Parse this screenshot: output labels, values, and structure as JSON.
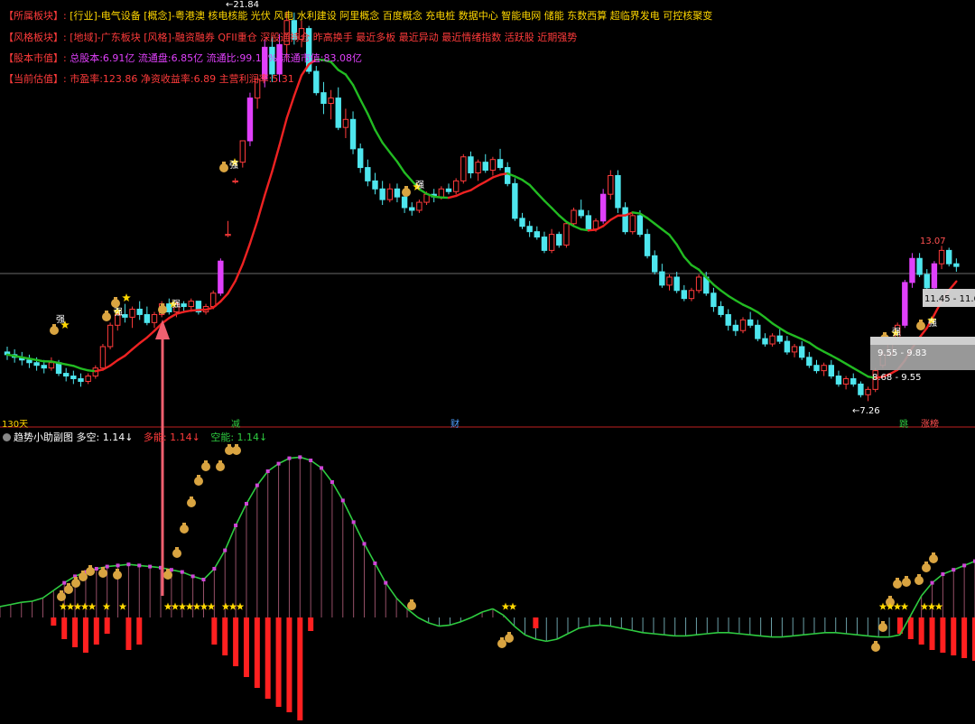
{
  "info": {
    "sector": {
      "tag": "【所属板块】:",
      "text": "[行业]-电气设备 [概念]-粤港澳 核电核能 光伏 风电 水利建设 阿里概念 百度概念 充电桩 数据中心 智能电网 储能 东数西算 超临界发电 可控核聚变"
    },
    "style": {
      "tag": "【风格板块】:",
      "text": "[地域]-广东板块 [风格]-融资融券 QFII重仓 深股通持仓 昨高换手 最近多板 最近异动 最近情绪指数 活跃股 近期强势"
    },
    "capital": {
      "tag": "【股本市值】:",
      "text": "总股本:6.91亿 流通盘:6.85亿 流通比:99.14% 流通市值:83.08亿"
    },
    "valuation": {
      "tag": "【当前估值】:",
      "text": "市盈率:123.86 净资收益率:6.89 主营利润率:5.31"
    }
  },
  "labels": {
    "high_price": "←21.84",
    "low_price": "←7.26",
    "right_high": "13.07",
    "zone_upper": "11.45 - 11.6",
    "zone_middle": "9.55 - 9.83",
    "zone_lower": "8.68 - 9.55",
    "period": "130天",
    "marker_reduce": "减",
    "marker_finance": "财",
    "marker_jump": "跳",
    "marker_limit": "涨榜",
    "strong": "强"
  },
  "indicator": {
    "name": "趋势小助副图",
    "ls_label": "多空: 1.14↓",
    "long_label": "多能: 1.14↓",
    "short_label": "空能: 1.14↓"
  },
  "colors": {
    "up": "#ff3b3b",
    "down": "#4ee6ee",
    "magenta": "#e040fb",
    "ma_rise": "#ee2222",
    "ma_fall": "#22bb22",
    "star": "#ffd700",
    "bag": "#d9a441"
  },
  "chart_data": {
    "type": "candlestick",
    "price_range": [
      7.26,
      21.84
    ],
    "candles": [
      [
        9.1,
        9.3,
        8.8,
        9.0
      ],
      [
        9.0,
        9.2,
        8.7,
        8.9
      ],
      [
        8.9,
        9.1,
        8.6,
        8.8
      ],
      [
        8.8,
        9.0,
        8.5,
        8.7
      ],
      [
        8.7,
        8.9,
        8.4,
        8.6
      ],
      [
        8.6,
        8.8,
        8.3,
        8.5
      ],
      [
        8.5,
        8.9,
        8.4,
        8.7
      ],
      [
        8.7,
        8.8,
        8.2,
        8.3
      ],
      [
        8.3,
        8.5,
        8.0,
        8.2
      ],
      [
        8.2,
        8.4,
        7.9,
        8.1
      ],
      [
        8.1,
        8.3,
        7.8,
        8.0
      ],
      [
        8.0,
        8.3,
        7.9,
        8.2
      ],
      [
        8.2,
        8.6,
        8.1,
        8.5
      ],
      [
        8.5,
        9.4,
        8.4,
        9.3
      ],
      [
        9.3,
        10.2,
        9.2,
        10.1
      ],
      [
        10.1,
        10.7,
        9.9,
        10.5
      ],
      [
        10.5,
        10.9,
        10.2,
        10.4
      ],
      [
        10.4,
        10.8,
        10.0,
        10.7
      ],
      [
        10.7,
        11.0,
        10.3,
        10.5
      ],
      [
        10.5,
        10.8,
        10.1,
        10.2
      ],
      [
        10.2,
        10.6,
        10.0,
        10.5
      ],
      [
        10.5,
        11.0,
        10.4,
        10.9
      ],
      [
        10.9,
        11.1,
        10.5,
        10.6
      ],
      [
        10.6,
        11.0,
        10.4,
        10.9
      ],
      [
        10.9,
        11.0,
        10.6,
        10.8
      ],
      [
        10.8,
        11.1,
        10.6,
        11.0
      ],
      [
        11.0,
        11.0,
        10.5,
        10.6
      ],
      [
        10.6,
        10.9,
        10.5,
        10.8
      ],
      [
        10.8,
        11.4,
        10.7,
        11.3
      ],
      [
        11.3,
        12.6,
        11.2,
        12.5
      ],
      [
        13.5,
        14.0,
        13.4,
        13.5
      ],
      [
        15.5,
        15.6,
        15.4,
        15.5
      ],
      [
        16.2,
        17.0,
        16.0,
        17.0
      ],
      [
        17.0,
        18.8,
        16.8,
        18.6
      ],
      [
        18.6,
        19.4,
        18.2,
        19.3
      ],
      [
        19.3,
        20.8,
        19.0,
        20.5
      ],
      [
        20.5,
        20.9,
        19.2,
        19.5
      ],
      [
        19.5,
        21.0,
        19.2,
        20.6
      ],
      [
        20.6,
        21.84,
        20.0,
        21.5
      ],
      [
        21.5,
        21.8,
        20.6,
        20.8
      ],
      [
        20.8,
        21.5,
        20.5,
        21.2
      ],
      [
        21.2,
        21.3,
        19.5,
        19.6
      ],
      [
        19.6,
        19.8,
        18.7,
        18.8
      ],
      [
        18.8,
        19.2,
        18.0,
        18.4
      ],
      [
        18.4,
        18.9,
        17.8,
        18.6
      ],
      [
        18.6,
        19.0,
        17.4,
        17.5
      ],
      [
        17.5,
        18.2,
        17.1,
        17.8
      ],
      [
        17.8,
        18.1,
        16.5,
        16.7
      ],
      [
        16.7,
        16.9,
        15.8,
        16.0
      ],
      [
        16.0,
        16.3,
        15.3,
        15.5
      ],
      [
        15.5,
        15.8,
        15.0,
        15.2
      ],
      [
        15.2,
        15.5,
        14.6,
        14.8
      ],
      [
        14.8,
        15.4,
        14.7,
        15.2
      ],
      [
        15.2,
        15.4,
        14.7,
        14.9
      ],
      [
        14.9,
        15.1,
        14.3,
        14.5
      ],
      [
        14.5,
        14.7,
        14.2,
        14.4
      ],
      [
        14.4,
        14.8,
        14.3,
        14.7
      ],
      [
        14.7,
        15.1,
        14.6,
        15.0
      ],
      [
        15.0,
        15.2,
        14.7,
        14.9
      ],
      [
        14.9,
        15.3,
        14.8,
        15.2
      ],
      [
        15.2,
        15.4,
        15.0,
        15.1
      ],
      [
        15.1,
        15.6,
        15.0,
        15.5
      ],
      [
        15.5,
        16.5,
        15.4,
        16.4
      ],
      [
        16.4,
        16.6,
        15.6,
        15.8
      ],
      [
        15.8,
        16.3,
        15.5,
        16.2
      ],
      [
        16.2,
        16.5,
        15.8,
        15.9
      ],
      [
        15.9,
        16.4,
        15.7,
        16.3
      ],
      [
        16.3,
        16.7,
        15.9,
        16.0
      ],
      [
        16.0,
        16.2,
        15.3,
        15.4
      ],
      [
        15.4,
        15.6,
        14.0,
        14.1
      ],
      [
        14.1,
        14.3,
        13.7,
        13.8
      ],
      [
        13.8,
        14.0,
        13.4,
        13.6
      ],
      [
        13.6,
        13.8,
        13.3,
        13.4
      ],
      [
        13.4,
        13.6,
        12.8,
        12.9
      ],
      [
        12.9,
        13.7,
        12.8,
        13.5
      ],
      [
        13.5,
        13.6,
        13.0,
        13.1
      ],
      [
        13.1,
        14.0,
        13.0,
        13.9
      ],
      [
        13.9,
        14.5,
        13.8,
        14.4
      ],
      [
        14.4,
        14.8,
        14.1,
        14.2
      ],
      [
        14.2,
        14.4,
        13.6,
        13.7
      ],
      [
        13.7,
        14.1,
        13.6,
        14.0
      ],
      [
        14.0,
        15.2,
        13.9,
        15.0
      ],
      [
        15.0,
        15.9,
        14.8,
        15.7
      ],
      [
        15.7,
        15.9,
        14.3,
        14.5
      ],
      [
        14.5,
        14.7,
        13.5,
        13.6
      ],
      [
        13.6,
        14.3,
        13.5,
        14.2
      ],
      [
        14.2,
        14.4,
        13.4,
        13.5
      ],
      [
        13.5,
        13.7,
        12.6,
        12.7
      ],
      [
        12.7,
        12.9,
        12.0,
        12.1
      ],
      [
        12.1,
        12.4,
        11.5,
        11.6
      ],
      [
        11.6,
        12.0,
        11.4,
        11.9
      ],
      [
        11.9,
        12.1,
        11.3,
        11.4
      ],
      [
        11.4,
        11.6,
        11.0,
        11.1
      ],
      [
        11.1,
        11.5,
        11.0,
        11.4
      ],
      [
        11.4,
        12.0,
        11.3,
        11.9
      ],
      [
        11.9,
        12.1,
        11.2,
        11.3
      ],
      [
        11.3,
        11.5,
        10.6,
        10.8
      ],
      [
        10.8,
        11.0,
        10.4,
        10.5
      ],
      [
        10.5,
        10.7,
        9.9,
        10.1
      ],
      [
        10.1,
        10.3,
        9.7,
        9.9
      ],
      [
        9.9,
        10.4,
        9.8,
        10.3
      ],
      [
        10.3,
        10.6,
        10.0,
        10.1
      ],
      [
        10.1,
        10.3,
        9.5,
        9.6
      ],
      [
        9.6,
        9.8,
        9.3,
        9.4
      ],
      [
        9.4,
        9.8,
        9.3,
        9.7
      ],
      [
        9.7,
        10.0,
        9.4,
        9.5
      ],
      [
        9.5,
        9.7,
        9.0,
        9.1
      ],
      [
        9.1,
        9.4,
        8.9,
        9.3
      ],
      [
        9.3,
        9.5,
        8.8,
        8.9
      ],
      [
        8.9,
        9.1,
        8.5,
        8.6
      ],
      [
        8.6,
        8.8,
        8.3,
        8.4
      ],
      [
        8.4,
        8.7,
        8.2,
        8.6
      ],
      [
        8.6,
        8.8,
        8.1,
        8.2
      ],
      [
        8.2,
        8.4,
        7.8,
        7.9
      ],
      [
        7.9,
        8.2,
        7.7,
        8.1
      ],
      [
        8.1,
        8.3,
        7.8,
        7.9
      ],
      [
        7.9,
        8.0,
        7.4,
        7.5
      ],
      [
        7.5,
        7.8,
        7.26,
        7.7
      ],
      [
        7.7,
        8.5,
        7.6,
        8.4
      ],
      [
        8.6,
        9.2,
        8.5,
        9.0
      ],
      [
        9.0,
        9.6,
        8.9,
        9.5
      ],
      [
        9.5,
        10.2,
        9.4,
        10.1
      ],
      [
        10.1,
        11.8,
        10.0,
        11.7
      ],
      [
        11.7,
        12.8,
        11.5,
        12.6
      ],
      [
        12.6,
        12.8,
        11.9,
        12.0
      ],
      [
        12.0,
        12.2,
        11.4,
        11.5
      ],
      [
        11.5,
        12.5,
        11.4,
        12.4
      ],
      [
        12.4,
        13.07,
        12.2,
        12.9
      ],
      [
        12.9,
        13.0,
        12.3,
        12.4
      ],
      [
        12.4,
        12.6,
        12.1,
        12.3
      ]
    ],
    "indicator": {
      "name": "趋势小助副图",
      "line": [
        1.1,
        1.12,
        1.14,
        1.15,
        1.18,
        1.25,
        1.32,
        1.38,
        1.42,
        1.45,
        1.47,
        1.48,
        1.49,
        1.48,
        1.47,
        1.46,
        1.44,
        1.42,
        1.38,
        1.35,
        1.45,
        1.62,
        1.85,
        2.05,
        2.22,
        2.35,
        2.42,
        2.47,
        2.48,
        2.45,
        2.38,
        2.25,
        2.08,
        1.88,
        1.68,
        1.5,
        1.32,
        1.18,
        1.08,
        1.0,
        0.95,
        0.92,
        0.93,
        0.96,
        1.0,
        1.05,
        1.08,
        1.02,
        0.92,
        0.84,
        0.8,
        0.78,
        0.8,
        0.85,
        0.9,
        0.92,
        0.93,
        0.92,
        0.9,
        0.88,
        0.86,
        0.85,
        0.84,
        0.83,
        0.83,
        0.84,
        0.85,
        0.86,
        0.86,
        0.85,
        0.84,
        0.83,
        0.82,
        0.82,
        0.83,
        0.84,
        0.85,
        0.86,
        0.86,
        0.85,
        0.84,
        0.83,
        0.82,
        0.82,
        0.84,
        1.02,
        1.2,
        1.32,
        1.4,
        1.44,
        1.48,
        1.52
      ],
      "bars": [
        0,
        0,
        0,
        0,
        0,
        0.3,
        0.8,
        1.1,
        1.3,
        1.0,
        0.6,
        0,
        1.2,
        1.0,
        0,
        0,
        0,
        0,
        0,
        0,
        1.0,
        1.4,
        1.8,
        2.2,
        2.6,
        3.0,
        3.3,
        3.5,
        3.8,
        0.5,
        0,
        0,
        0,
        0,
        0,
        0,
        0,
        0,
        0,
        0,
        0,
        0,
        0,
        0,
        0,
        0,
        0,
        0,
        0,
        0,
        0.4,
        0,
        0,
        0,
        0,
        0,
        0,
        0,
        0,
        0,
        0,
        0,
        0,
        0,
        0,
        0,
        0,
        0,
        0,
        0,
        0,
        0,
        0,
        0,
        0,
        0,
        0,
        0,
        0,
        0,
        0,
        0,
        0,
        0,
        0.6,
        0.8,
        1.0,
        1.2,
        1.3,
        1.4,
        1.5,
        1.6
      ]
    }
  }
}
